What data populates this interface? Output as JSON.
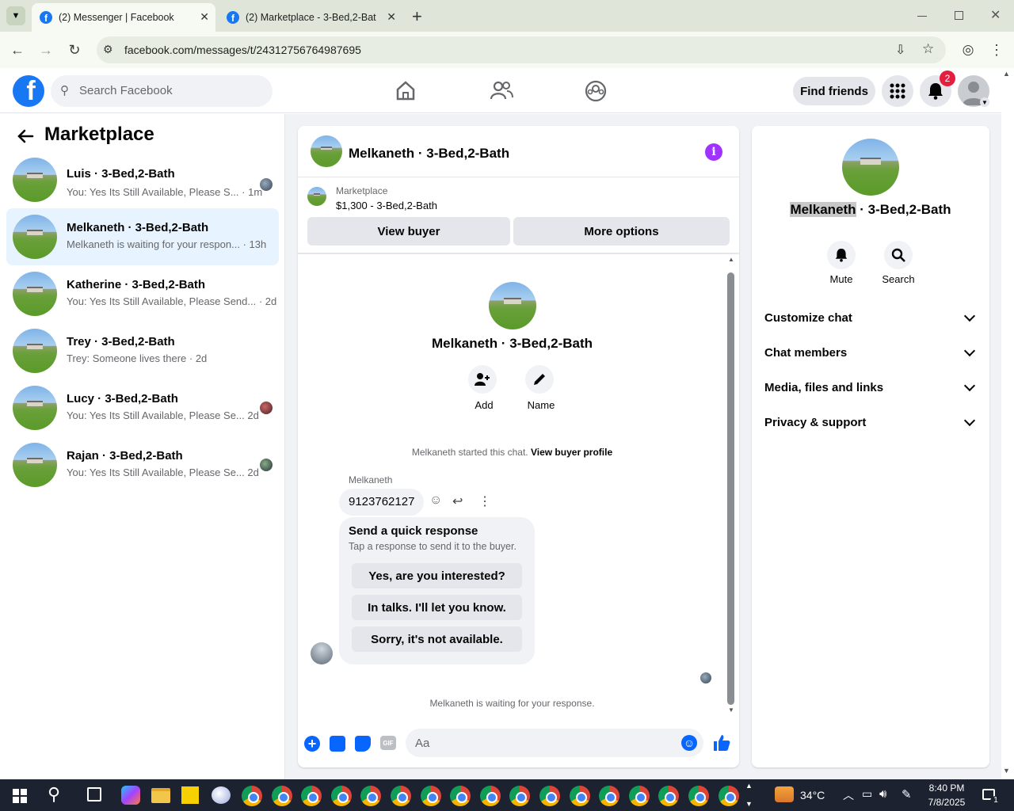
{
  "browser": {
    "tabs": [
      {
        "title": "(2) Messenger | Facebook",
        "active": true
      },
      {
        "title": "(2) Marketplace - 3-Bed,2-Bath",
        "active": false
      }
    ],
    "url": "facebook.com/messages/t/24312756764987695",
    "icons": [
      "tab-search-icon",
      "back-icon",
      "forward-icon",
      "reload-icon",
      "site-info-icon",
      "install-icon",
      "star-icon",
      "profile-icon",
      "menu-icon"
    ]
  },
  "fb_header": {
    "search_placeholder": "Search Facebook",
    "find_friends": "Find friends",
    "notification_count": "2"
  },
  "left_panel": {
    "title": "Marketplace",
    "conversations": [
      {
        "name": "Luis · 3-Bed,2-Bath",
        "snippet": "You: Yes Its Still Available, Please S...",
        "time": "· 1m",
        "selected": false
      },
      {
        "name": "Melkaneth · 3-Bed,2-Bath",
        "snippet": "Melkaneth is waiting for your respon...",
        "time": "· 13h",
        "selected": true
      },
      {
        "name": "Katherine · 3-Bed,2-Bath",
        "snippet": "You: Yes Its Still Available, Please Send...",
        "time": "· 2d",
        "selected": false
      },
      {
        "name": "Trey · 3-Bed,2-Bath",
        "snippet": "Trey: Someone lives there",
        "time": "· 2d",
        "selected": false
      },
      {
        "name": "Lucy · 3-Bed,2-Bath",
        "snippet": "You: Yes Its Still Available, Please Se...",
        "time": "2d",
        "selected": false
      },
      {
        "name": "Rajan · 3-Bed,2-Bath",
        "snippet": "You: Yes Its Still Available, Please Se...",
        "time": "2d",
        "selected": false
      }
    ]
  },
  "chat": {
    "header_title": "Melkaneth · 3-Bed,2-Bath",
    "listing_label": "Marketplace",
    "listing_price": "$1,300 - 3-Bed,2-Bath",
    "view_buyer": "View buyer",
    "more_options": "More options",
    "profile_name": "Melkaneth · 3-Bed,2-Bath",
    "add_label": "Add",
    "name_label": "Name",
    "started_text": "Melkaneth started this chat.",
    "view_buyer_profile": "View buyer profile",
    "sender": "Melkaneth",
    "message": "9123762127",
    "quick_title": "Send a quick response",
    "quick_sub": "Tap a response to send it to the buyer.",
    "quick_responses": [
      "Yes, are you interested?",
      "In talks. I'll let you know.",
      "Sorry, it's not available."
    ],
    "waiting_text": "Melkaneth is waiting for your response.",
    "composer_placeholder": "Aa"
  },
  "info_panel": {
    "name_highlight": "Melkaneth",
    "name_rest": " · 3-Bed,2-Bath",
    "mute": "Mute",
    "search": "Search",
    "sections": [
      "Customize chat",
      "Chat members",
      "Media, files and links",
      "Privacy & support"
    ]
  },
  "taskbar": {
    "temperature": "34°C",
    "time": "8:40 PM",
    "date": "7/8/2025",
    "notification_badge": "1"
  },
  "colors": {
    "fb_blue": "#1877f2",
    "selected_bg": "#e7f3ff",
    "badge_red": "#e41e3f",
    "info_purple": "#a033ff"
  }
}
